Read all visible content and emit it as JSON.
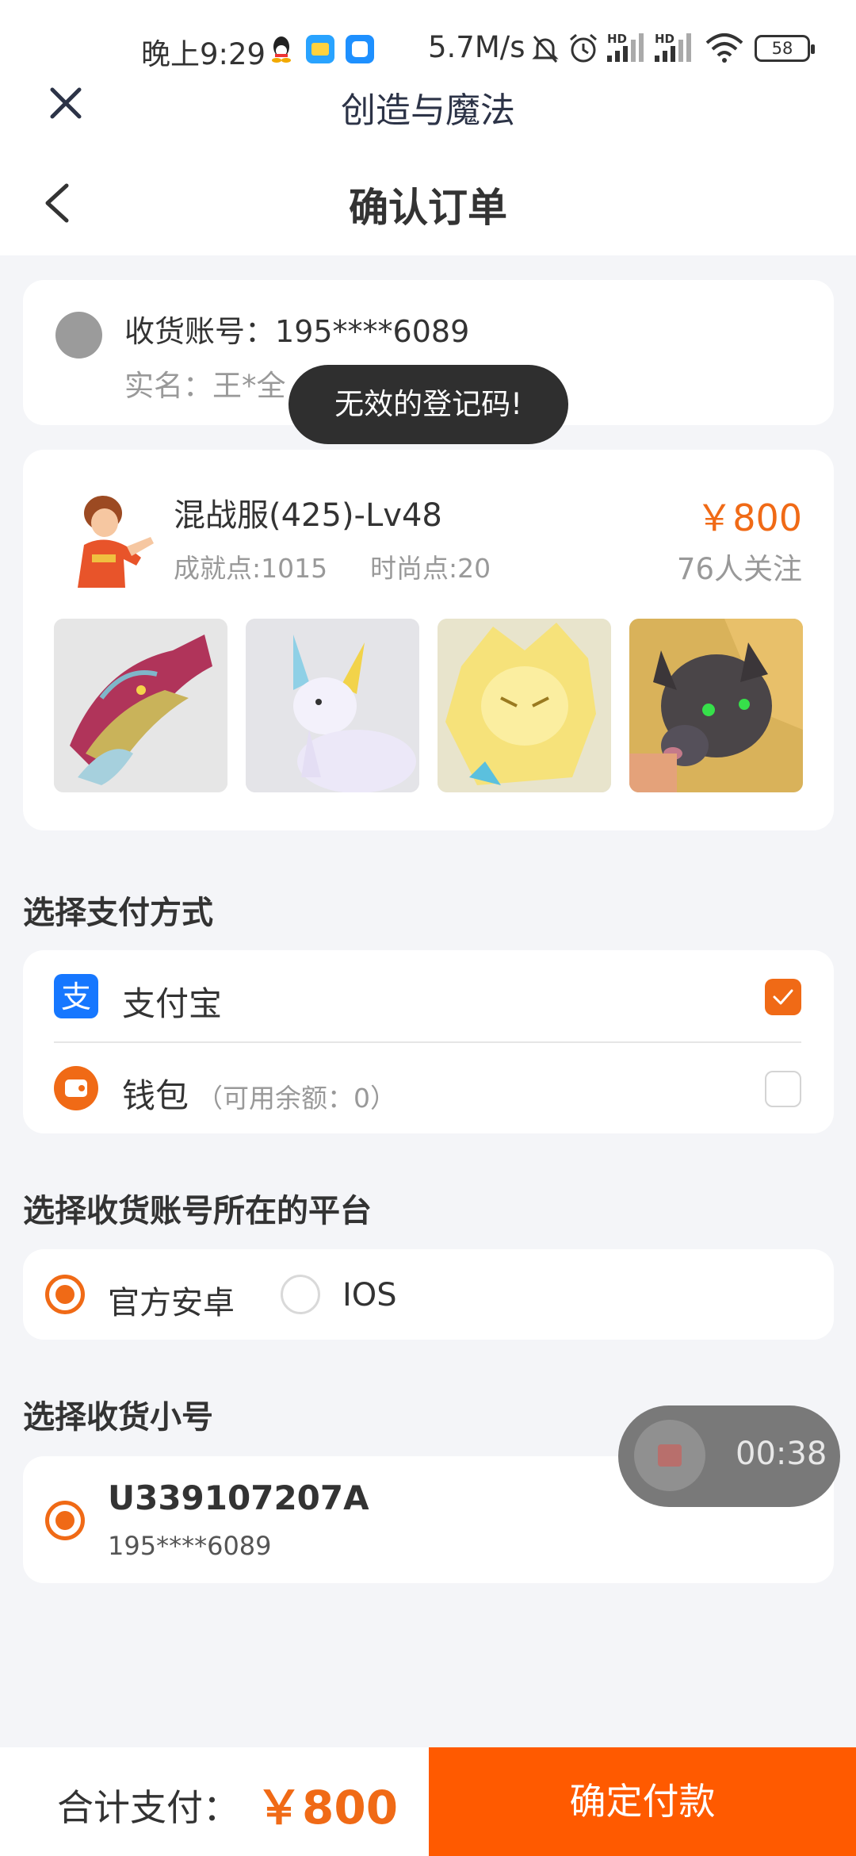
{
  "status_bar": {
    "time": "晚上9:29",
    "net_speed": "5.7M/s",
    "battery": "58",
    "network_labels": [
      "HD",
      "HD"
    ]
  },
  "mini_program": {
    "title": "创造与魔法"
  },
  "nav": {
    "title": "确认订单"
  },
  "account": {
    "label": "收货账号：",
    "phone": "195****6089",
    "name_label": "实名：",
    "name": "王*全"
  },
  "toast": {
    "text": "无效的登记码!"
  },
  "product": {
    "name": "混战服(425)-Lv48",
    "achievement": "成就点:1015",
    "fashion": "时尚点:20",
    "price": "￥800",
    "followers": "76人关注",
    "thumbnails": [
      "dragon",
      "white-fox",
      "golden-lion",
      "dark-wolf"
    ]
  },
  "payment": {
    "heading": "选择支付方式",
    "options": [
      {
        "label": "支付宝",
        "note": "",
        "checked": true
      },
      {
        "label": "钱包",
        "note": "（可用余额：0）",
        "checked": false
      }
    ]
  },
  "platform": {
    "heading": "选择收货账号所在的平台",
    "options": [
      {
        "label": "官方安卓",
        "selected": true
      },
      {
        "label": "IOS",
        "selected": false
      }
    ]
  },
  "sub_account": {
    "heading": "选择收货小号",
    "id": "U339107207A",
    "phone": "195****6089"
  },
  "recording": {
    "time": "00:38"
  },
  "footer": {
    "total_label": "合计支付：",
    "total_amount": "￥800",
    "pay_button": "确定付款"
  },
  "colors": {
    "accent": "#f06a16",
    "pay_button": "#ff5a00",
    "alipay": "#1677ff"
  }
}
